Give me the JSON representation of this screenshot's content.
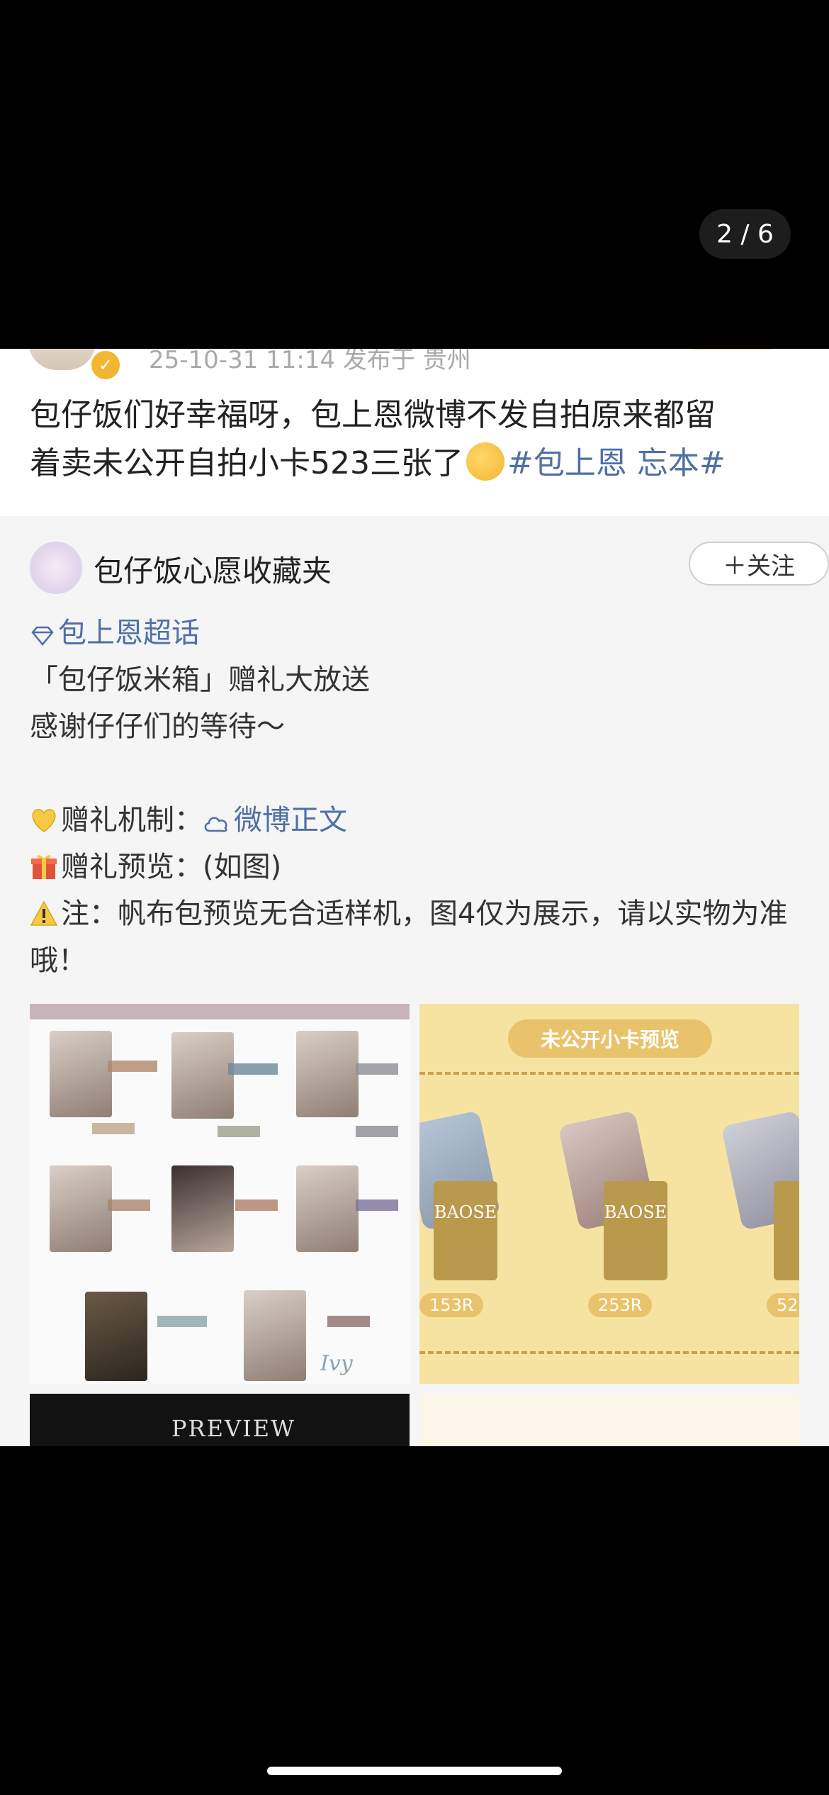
{
  "viewer": {
    "counter": "2 / 6"
  },
  "post": {
    "meta": "25-10-31 11:14  发布于 贵州",
    "text_line1": "包仔饭们好幸福呀，包上恩微博不发自拍原来都留",
    "text_line2": "着卖未公开自拍小卡523三张了",
    "topic": "#包上恩 忘本#",
    "emoji": "shushing-face-emoji"
  },
  "repost": {
    "author": "包仔饭心愿收藏夹",
    "follow_label": "＋关注",
    "supertopic": "包上恩超话",
    "line1": "「包仔饭米箱」赠礼大放送",
    "line2": "感谢仔仔们的等待～",
    "mechanism_label": "赠礼机制：",
    "mechanism_link": "微博正文",
    "preview_label": "赠礼预览：(如图)",
    "note": "注：帆布包预览无合适样机，图4仅为展示，请以实物为准哦！"
  },
  "images": {
    "img2_banner": "未公开小卡预览",
    "img2_prices": [
      "153R",
      "253R",
      "52"
    ],
    "img2_card_text": "BAOSE",
    "img1_ivy": "Ivy",
    "img3_text": "PREVIEW"
  },
  "colors": {
    "link": "#4f6fa6",
    "gold": "#e9c36b"
  }
}
